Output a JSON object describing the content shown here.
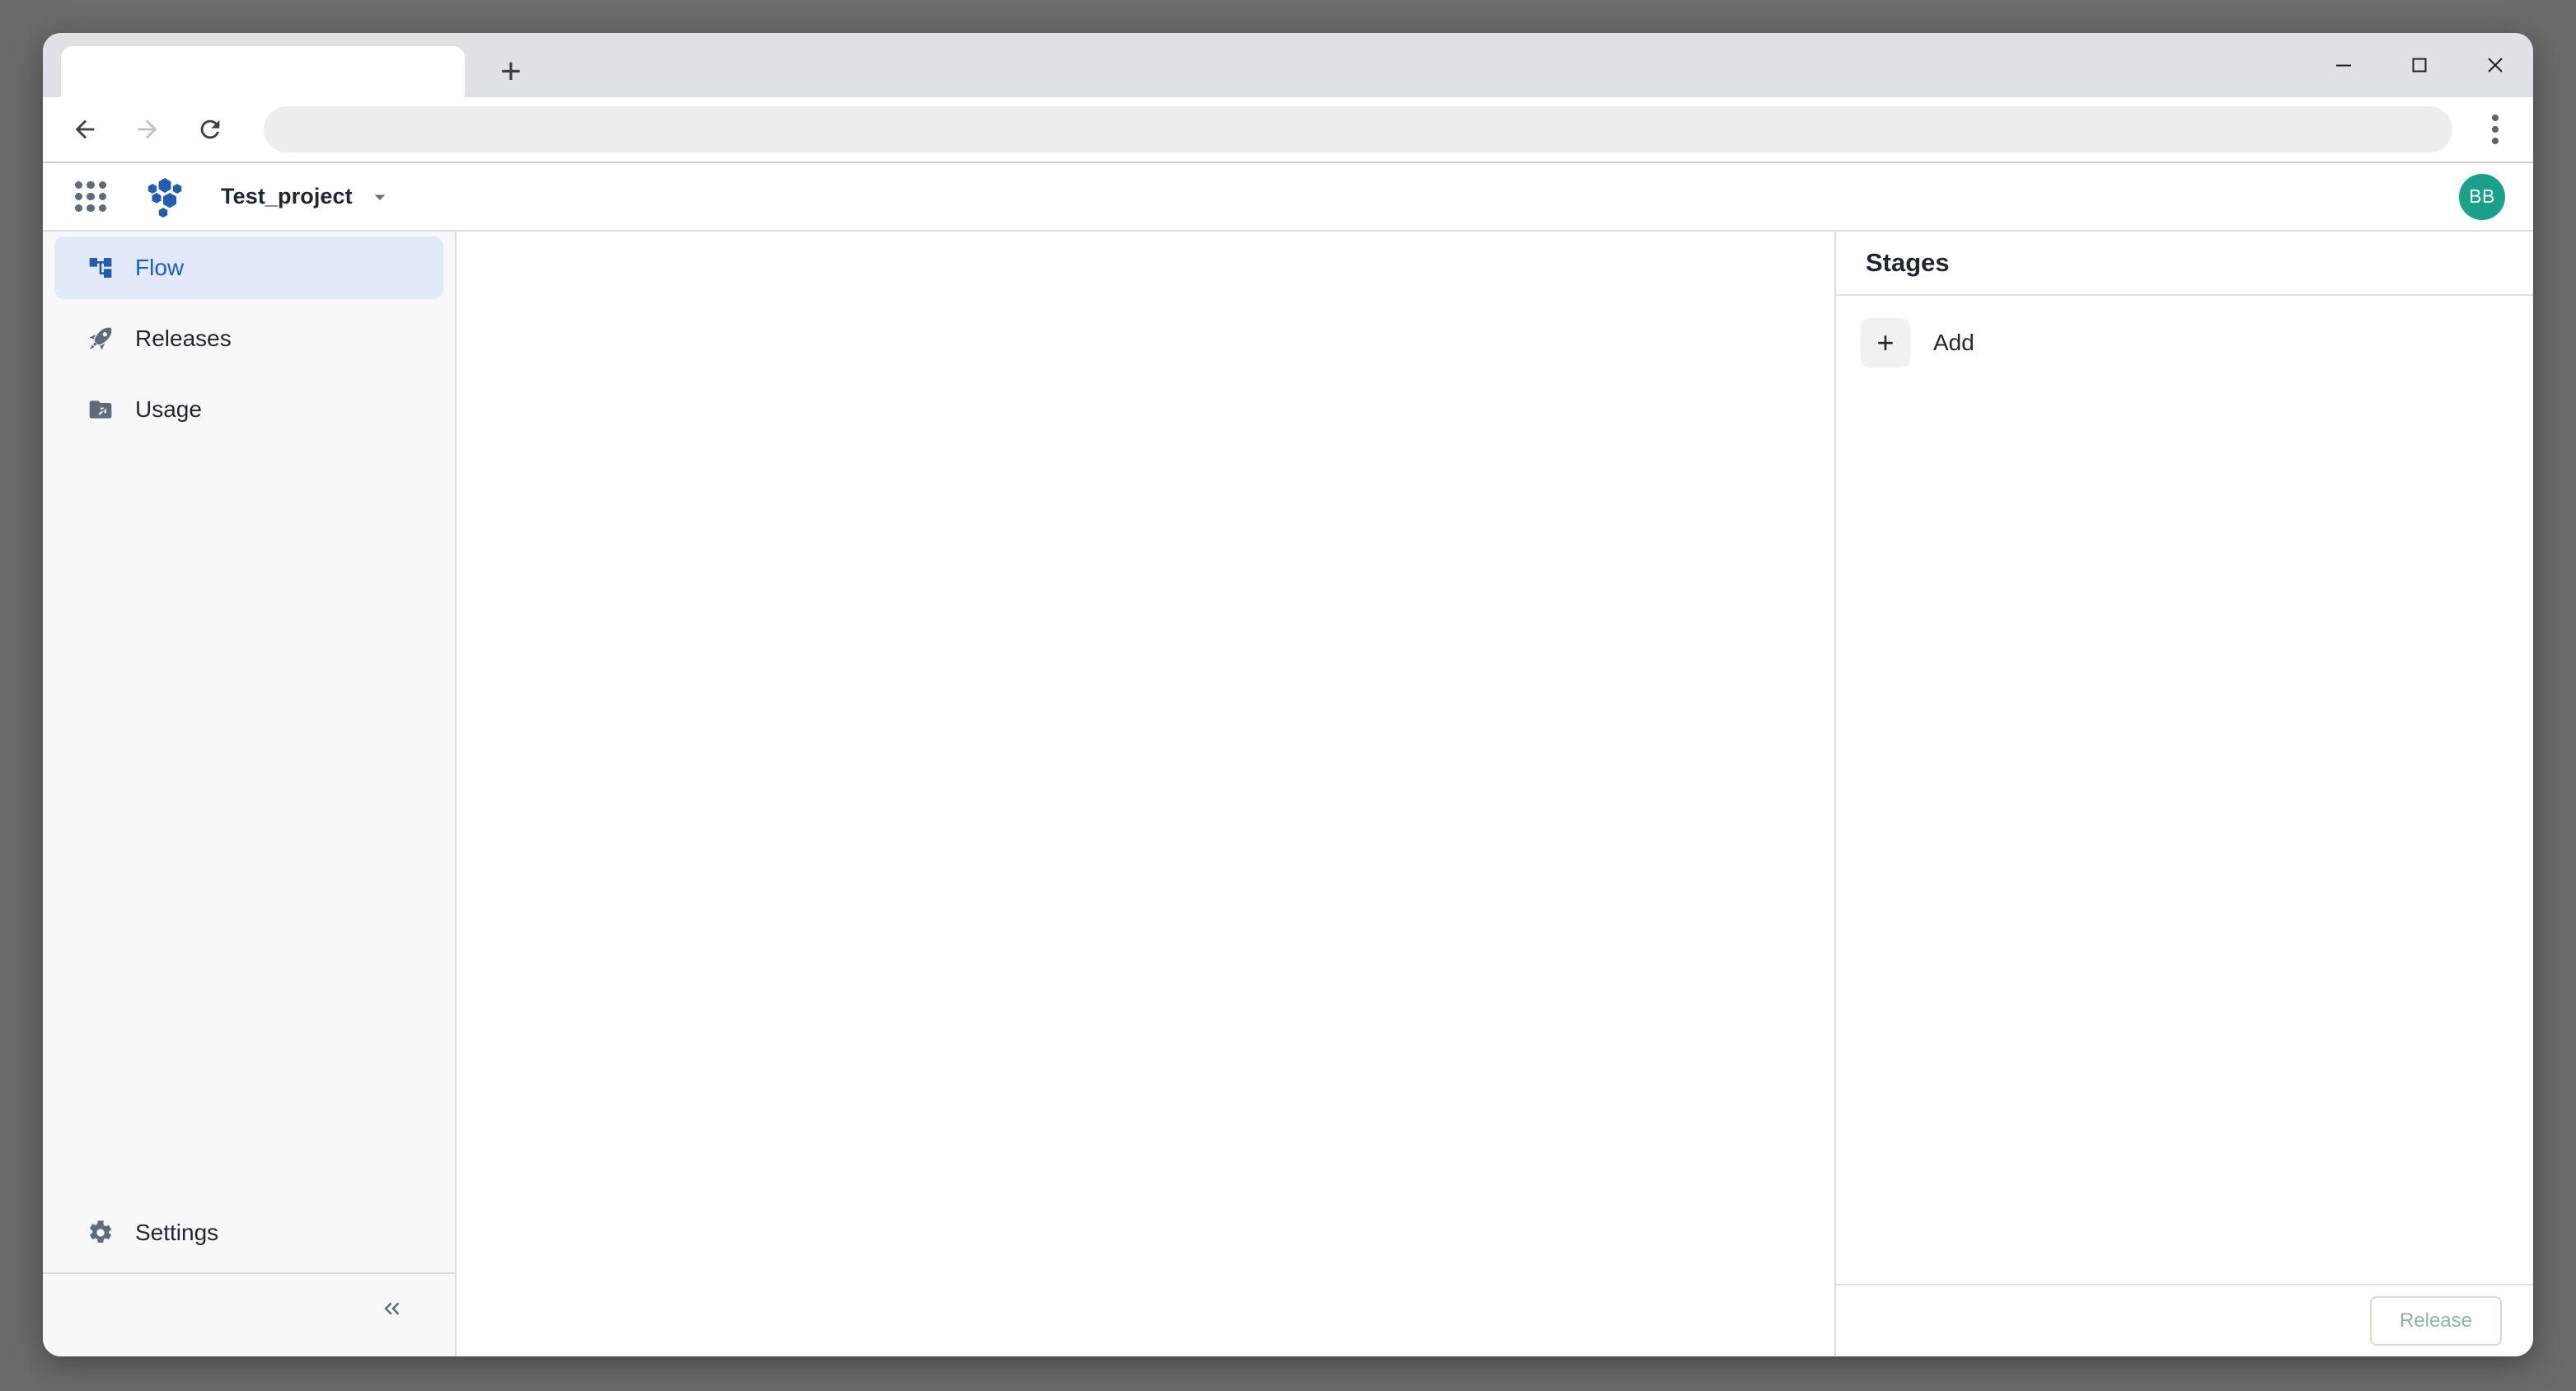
{
  "browser": {
    "tab": {
      "title": "",
      "name": "browser-tab"
    },
    "new_tab_label": "+",
    "window_controls": {
      "minimize": "Minimize",
      "maximize": "Maximize",
      "close": "Close"
    },
    "nav": {
      "back": "Back",
      "forward": "Forward",
      "reload": "Reload"
    },
    "omnibox": {
      "value": "",
      "placeholder": ""
    },
    "menu_label": "Customize and control"
  },
  "app_header": {
    "apps_grid_label": "Apps",
    "logo_name": "hexagon-cluster-logo",
    "project_name": "Test_project",
    "project_caret": "chevron-down",
    "avatar_initials": "BB"
  },
  "sidebar": {
    "items": [
      {
        "label": "Flow",
        "icon": "account-tree-icon",
        "active": true
      },
      {
        "label": "Releases",
        "icon": "rocket-icon",
        "active": false
      },
      {
        "label": "Usage",
        "icon": "folder-export-icon",
        "active": false
      }
    ],
    "settings": {
      "label": "Settings",
      "icon": "gear-icon"
    },
    "collapse_label": "«"
  },
  "right_panel": {
    "title": "Stages",
    "add": {
      "plus": "+",
      "label": "Add"
    },
    "release_button": {
      "label": "Release",
      "enabled": false
    }
  },
  "colors": {
    "accent_blue": "#1a5fc4",
    "active_nav_bg": "#e2e9f8",
    "avatar_teal": "#1ba18b",
    "release_green": "#8fb79b",
    "chrome_gray": "#dee1e6",
    "sidebar_bg": "#f6f8fa"
  }
}
